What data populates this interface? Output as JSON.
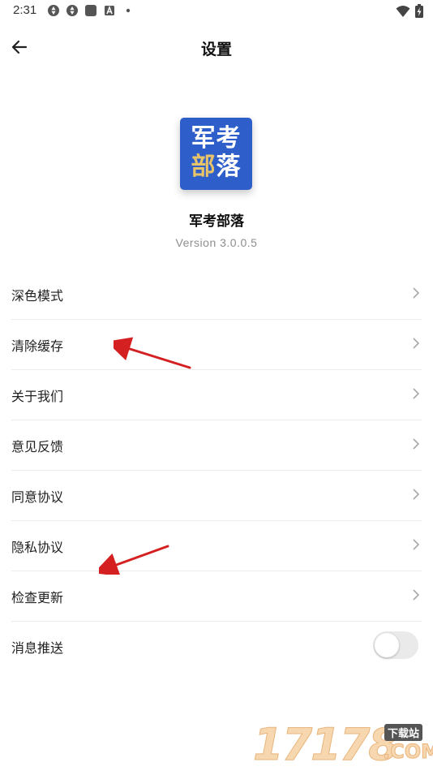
{
  "status_bar": {
    "time": "2:31",
    "left_icons": [
      "aperture-icon",
      "aperture-icon",
      "app-square-icon",
      "a-letter-icon",
      "dot-icon"
    ],
    "right_icons": [
      "wifi-icon",
      "battery-charging-icon"
    ]
  },
  "header": {
    "back_icon": "arrow-left-icon",
    "title": "设置"
  },
  "app": {
    "logo_line1": "军考",
    "logo_line2_char1": "部",
    "logo_line2_char2": "落",
    "name": "军考部落",
    "version": "Version 3.0.0.5"
  },
  "settings": {
    "items": [
      {
        "label": "深色模式",
        "control": "chevron"
      },
      {
        "label": "清除缓存",
        "control": "chevron"
      },
      {
        "label": "关于我们",
        "control": "chevron"
      },
      {
        "label": "意见反馈",
        "control": "chevron"
      },
      {
        "label": "同意协议",
        "control": "chevron"
      },
      {
        "label": "隐私协议",
        "control": "chevron"
      },
      {
        "label": "检查更新",
        "control": "chevron"
      },
      {
        "label": "消息推送",
        "control": "toggle",
        "toggle_on": false
      }
    ]
  },
  "watermark": {
    "digits": "17178",
    "badge": "下载站",
    "domain": ".COM"
  },
  "colors": {
    "logo_bg": "#2d5ec9",
    "logo_accent": "#e7c46a",
    "annotation_arrow": "#d42020",
    "divider": "#ececec",
    "toggle_off": "#eaeaea"
  }
}
